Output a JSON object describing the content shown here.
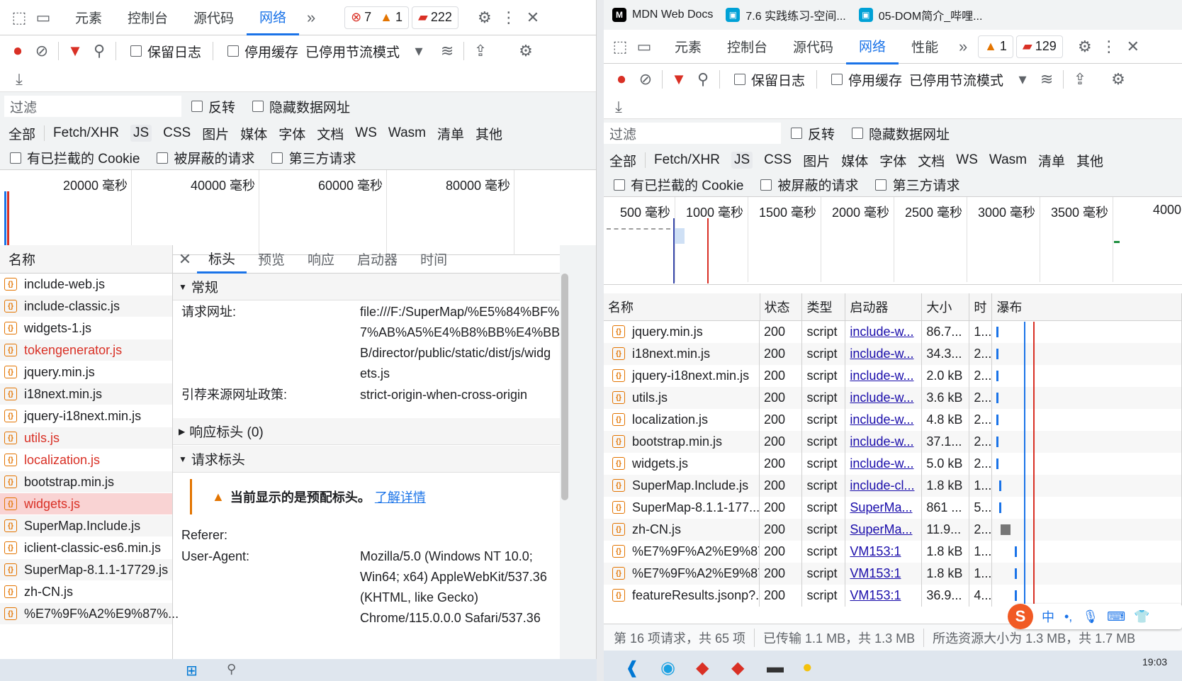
{
  "left": {
    "tabs": [
      "元素",
      "控制台",
      "源代码",
      "网络"
    ],
    "active_tab": "网络",
    "errors": "7",
    "warnings": "1",
    "issues": "222",
    "toolbar": {
      "preserve_log": "保留日志",
      "disable_cache": "停用缓存",
      "throttle": "已停用节流模式"
    },
    "filter": {
      "placeholder": "过滤",
      "invert": "反转",
      "hide_data": "隐藏数据网址"
    },
    "types": [
      "全部",
      "Fetch/XHR",
      "JS",
      "CSS",
      "图片",
      "媒体",
      "字体",
      "文档",
      "WS",
      "Wasm",
      "清单",
      "其他"
    ],
    "checks": [
      "有已拦截的 Cookie",
      "被屏蔽的请求",
      "第三方请求"
    ],
    "timeline": [
      "20000 毫秒",
      "40000 毫秒",
      "60000 毫秒",
      "80000 毫秒"
    ],
    "name_header": "名称",
    "files": [
      {
        "name": "include-web.js",
        "color": "normal"
      },
      {
        "name": "include-classic.js",
        "color": "normal"
      },
      {
        "name": "widgets-1.js",
        "color": "normal"
      },
      {
        "name": "tokengenerator.js",
        "color": "red"
      },
      {
        "name": "jquery.min.js",
        "color": "normal"
      },
      {
        "name": "i18next.min.js",
        "color": "normal"
      },
      {
        "name": "jquery-i18next.min.js",
        "color": "normal"
      },
      {
        "name": "utils.js",
        "color": "red"
      },
      {
        "name": "localization.js",
        "color": "red"
      },
      {
        "name": "bootstrap.min.js",
        "color": "normal"
      },
      {
        "name": "widgets.js",
        "color": "selected"
      },
      {
        "name": "SuperMap.Include.js",
        "color": "normal"
      },
      {
        "name": "iclient-classic-es6.min.js",
        "color": "normal"
      },
      {
        "name": "SuperMap-8.1.1-17729.js",
        "color": "normal"
      },
      {
        "name": "zh-CN.js",
        "color": "normal"
      },
      {
        "name": "%E7%9F%A2%E9%87%...",
        "color": "normal"
      }
    ],
    "detail_tabs": [
      "标头",
      "预览",
      "响应",
      "启动器",
      "时间"
    ],
    "general": "常规",
    "request_url_label": "请求网址:",
    "request_url_lines": [
      "file:///F:/SuperMap/%E5%84%BF%E",
      "7%AB%A5%E4%B8%BB%E4%BB%B",
      "B/director/public/static/dist/js/widg",
      "ets.js"
    ],
    "referrer_policy_label": "引荐来源网址政策:",
    "referrer_policy": "strict-origin-when-cross-origin",
    "response_headers": "响应标头 (0)",
    "request_headers": "请求标头",
    "warning_text": "当前显示的是预配标头。",
    "learn_more": "了解详情",
    "referer_label": "Referer:",
    "ua_label": "User-Agent:",
    "ua_lines": [
      "Mozilla/5.0 (Windows NT 10.0;",
      "Win64; x64) AppleWebKit/537.36",
      "(KHTML, like Gecko)",
      "Chrome/115.0.0.0 Safari/537.36"
    ]
  },
  "right": {
    "browser_tabs": [
      "MDN Web Docs",
      "7.6 实践练习-空间...",
      "05-DOM简介_哔哩..."
    ],
    "tabs": [
      "元素",
      "控制台",
      "源代码",
      "网络",
      "性能"
    ],
    "active_tab": "网络",
    "warnings": "1",
    "issues": "129",
    "toolbar": {
      "preserve_log": "保留日志",
      "disable_cache": "停用缓存",
      "throttle": "已停用节流模式"
    },
    "filter": {
      "placeholder": "过滤",
      "invert": "反转",
      "hide_data": "隐藏数据网址"
    },
    "types": [
      "全部",
      "Fetch/XHR",
      "JS",
      "CSS",
      "图片",
      "媒体",
      "字体",
      "文档",
      "WS",
      "Wasm",
      "清单",
      "其他"
    ],
    "checks": [
      "有已拦截的 Cookie",
      "被屏蔽的请求",
      "第三方请求"
    ],
    "timeline": [
      "500 毫秒",
      "1000 毫秒",
      "1500 毫秒",
      "2000 毫秒",
      "2500 毫秒",
      "3000 毫秒",
      "3500 毫秒",
      "4000"
    ],
    "columns": [
      "名称",
      "状态",
      "类型",
      "启动器",
      "大小",
      "时",
      "瀑布"
    ],
    "rows": [
      {
        "name": "jquery.min.js",
        "status": "200",
        "type": "script",
        "init": "include-w...",
        "size": "86.7...",
        "time": "1..."
      },
      {
        "name": "i18next.min.js",
        "status": "200",
        "type": "script",
        "init": "include-w...",
        "size": "34.3...",
        "time": "2..."
      },
      {
        "name": "jquery-i18next.min.js",
        "status": "200",
        "type": "script",
        "init": "include-w...",
        "size": "2.0 kB",
        "time": "2..."
      },
      {
        "name": "utils.js",
        "status": "200",
        "type": "script",
        "init": "include-w...",
        "size": "3.6 kB",
        "time": "2..."
      },
      {
        "name": "localization.js",
        "status": "200",
        "type": "script",
        "init": "include-w...",
        "size": "4.8 kB",
        "time": "2..."
      },
      {
        "name": "bootstrap.min.js",
        "status": "200",
        "type": "script",
        "init": "include-w...",
        "size": "37.1...",
        "time": "2..."
      },
      {
        "name": "widgets.js",
        "status": "200",
        "type": "script",
        "init": "include-w...",
        "size": "5.0 kB",
        "time": "2..."
      },
      {
        "name": "SuperMap.Include.js",
        "status": "200",
        "type": "script",
        "init": "include-cl...",
        "size": "1.8 kB",
        "time": "1..."
      },
      {
        "name": "SuperMap-8.1.1-177...",
        "status": "200",
        "type": "script",
        "init": "SuperMa...",
        "size": "861 ...",
        "time": "5..."
      },
      {
        "name": "zh-CN.js",
        "status": "200",
        "type": "script",
        "init": "SuperMa...",
        "size": "11.9...",
        "time": "2..."
      },
      {
        "name": "%E7%9F%A2%E9%87...",
        "status": "200",
        "type": "script",
        "init": "VM153:1",
        "size": "1.8 kB",
        "time": "1..."
      },
      {
        "name": "%E7%9F%A2%E9%87...",
        "status": "200",
        "type": "script",
        "init": "VM153:1",
        "size": "1.8 kB",
        "time": "1..."
      },
      {
        "name": "featureResults.jsonp?...",
        "status": "200",
        "type": "script",
        "init": "VM153:1",
        "size": "36.9...",
        "time": "4..."
      }
    ],
    "status": {
      "requests": "第 16 项请求，共 65 项",
      "transferred": "已传输 1.1 MB，共 1.3 MB",
      "resources": "所选资源大小为 1.3 MB，共 1.7 MB"
    },
    "clock": "19:03",
    "ime": "中"
  }
}
